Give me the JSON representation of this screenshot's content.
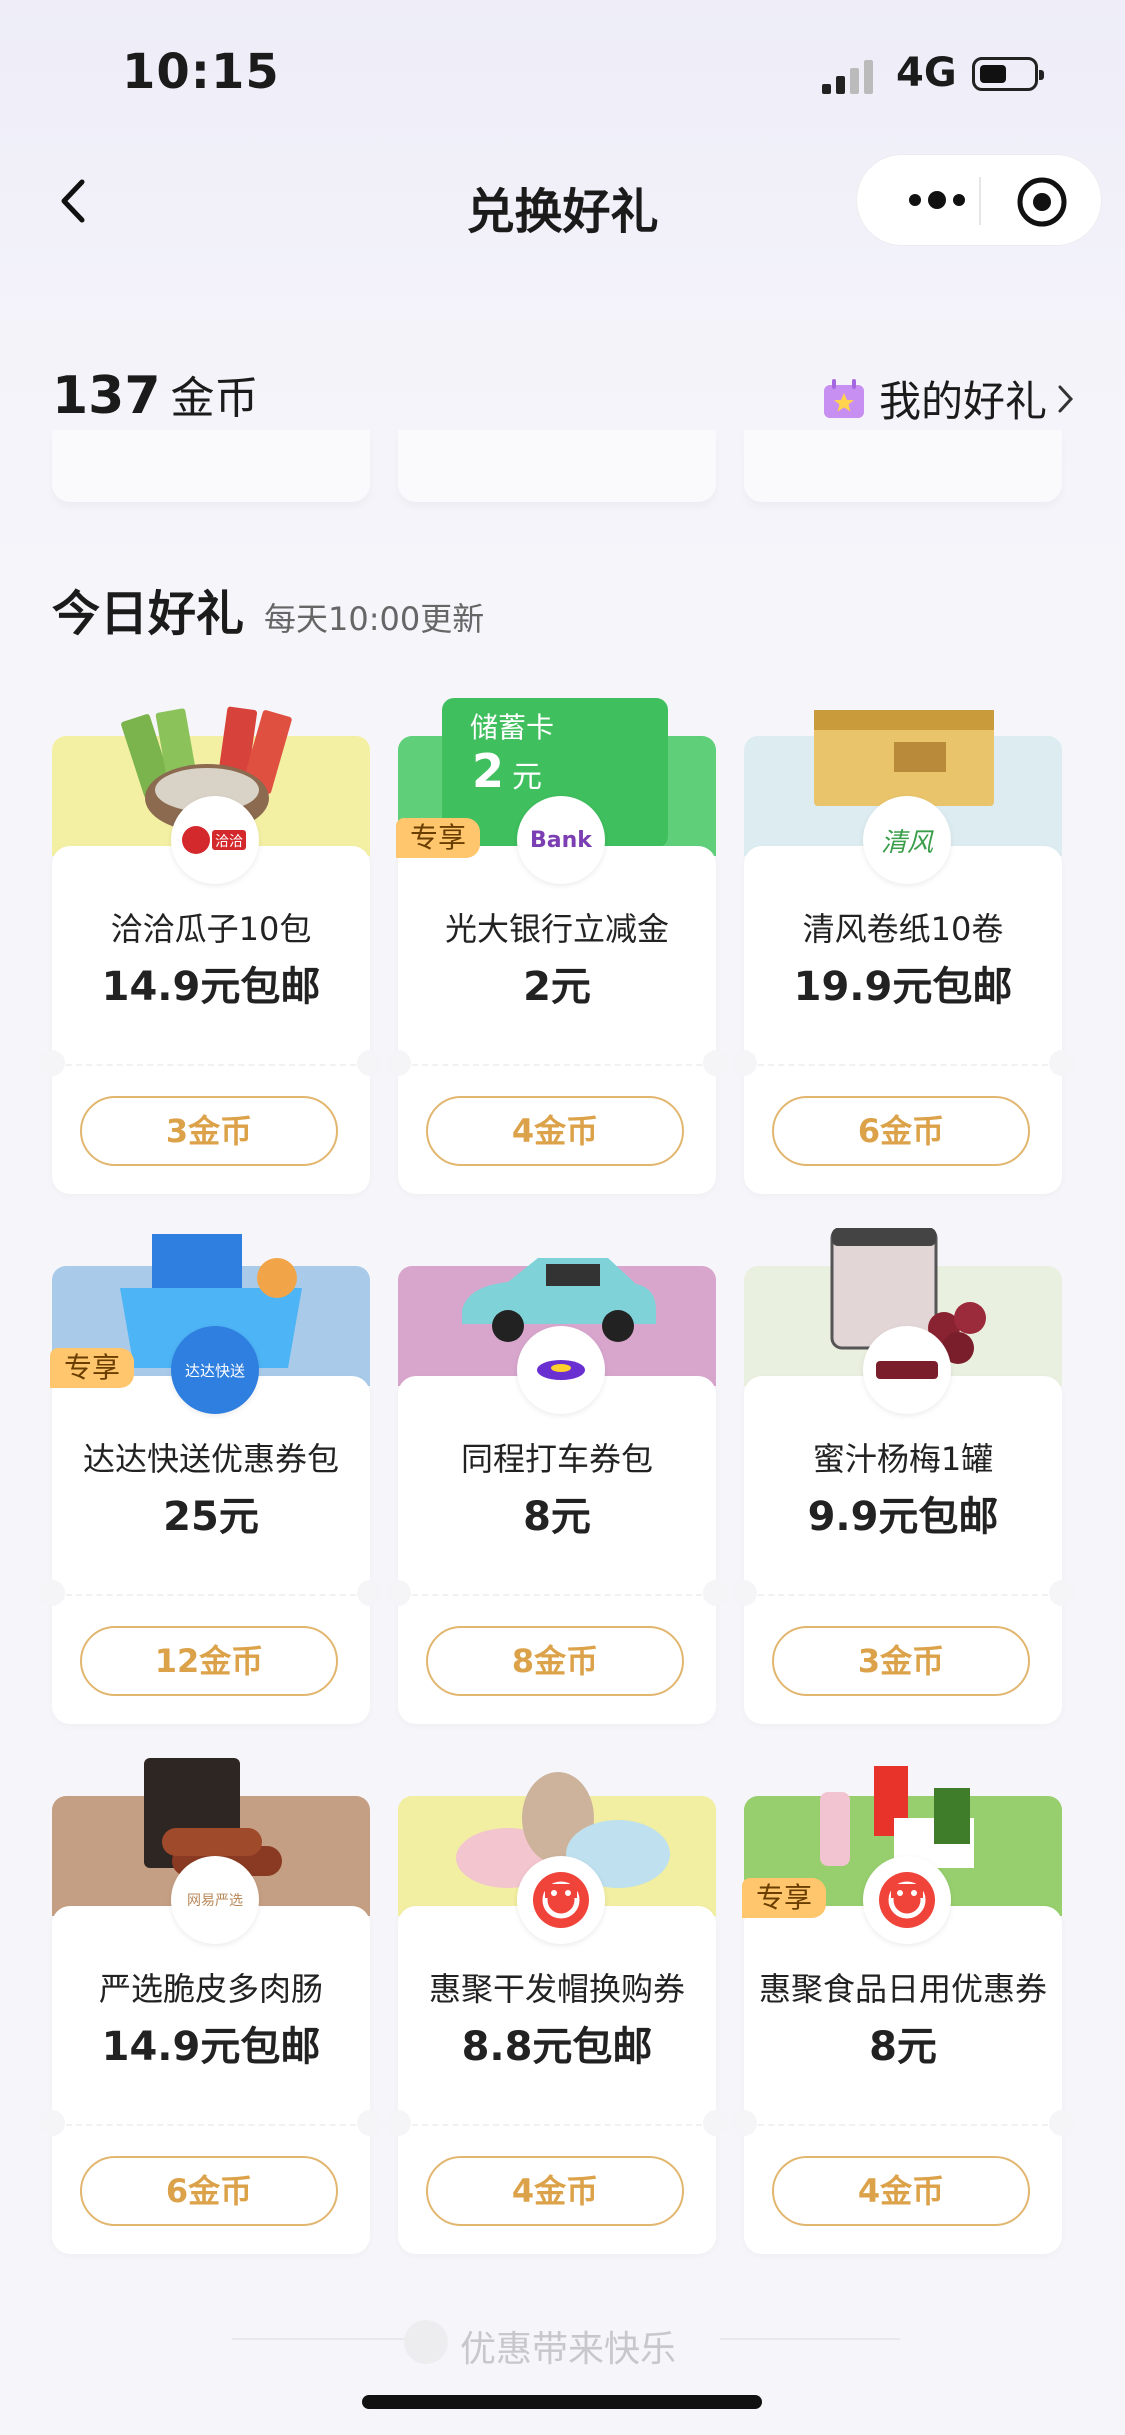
{
  "status": {
    "time": "10:15",
    "network": "4G"
  },
  "nav": {
    "title": "兑换好礼"
  },
  "header": {
    "coins_value": "137",
    "coins_unit": "金币",
    "my_gifts": "我的好礼"
  },
  "section": {
    "title": "今日好礼",
    "subtitle": "每天10:00更新"
  },
  "gifts": [
    {
      "name": "洽洽瓜子10包",
      "price": "14.9元包邮",
      "cost": "3金币",
      "badge": "",
      "bg": "#f3f0a4",
      "logo": "洽洽"
    },
    {
      "name": "光大银行立减金",
      "price": "2元",
      "cost": "4金币",
      "badge": "专享",
      "bg": "#5fcf7a",
      "logo": "Bank",
      "card_label": "储蓄卡",
      "card_amount": "2",
      "card_unit": "元"
    },
    {
      "name": "清风卷纸10卷",
      "price": "19.9元包邮",
      "cost": "6金币",
      "badge": "",
      "bg": "#dcecf0",
      "logo": "清风"
    },
    {
      "name": "达达快送优惠券包",
      "price": "25元",
      "cost": "12金币",
      "badge": "专享",
      "bg": "#a9cbe9",
      "logo": "达达快送"
    },
    {
      "name": "同程打车券包",
      "price": "8元",
      "cost": "8金币",
      "badge": "",
      "bg": "#d8a6cd",
      "logo": ""
    },
    {
      "name": "蜜汁杨梅1罐",
      "price": "9.9元包邮",
      "cost": "3金币",
      "badge": "",
      "bg": "#eaf0e0",
      "logo": ""
    },
    {
      "name": "严选脆皮多肉肠",
      "price": "14.9元包邮",
      "cost": "6金币",
      "badge": "",
      "bg": "#c59f83",
      "logo": "网易严选"
    },
    {
      "name": "惠聚干发帽换购券",
      "price": "8.8元包邮",
      "cost": "4金币",
      "badge": "",
      "bg": "#f2eea2",
      "logo": ""
    },
    {
      "name": "惠聚食品日用优惠券",
      "price": "8元",
      "cost": "4金币",
      "badge": "专享",
      "bg": "#97cf6f",
      "logo": ""
    }
  ],
  "footer": {
    "slogan": "优惠带来快乐"
  }
}
